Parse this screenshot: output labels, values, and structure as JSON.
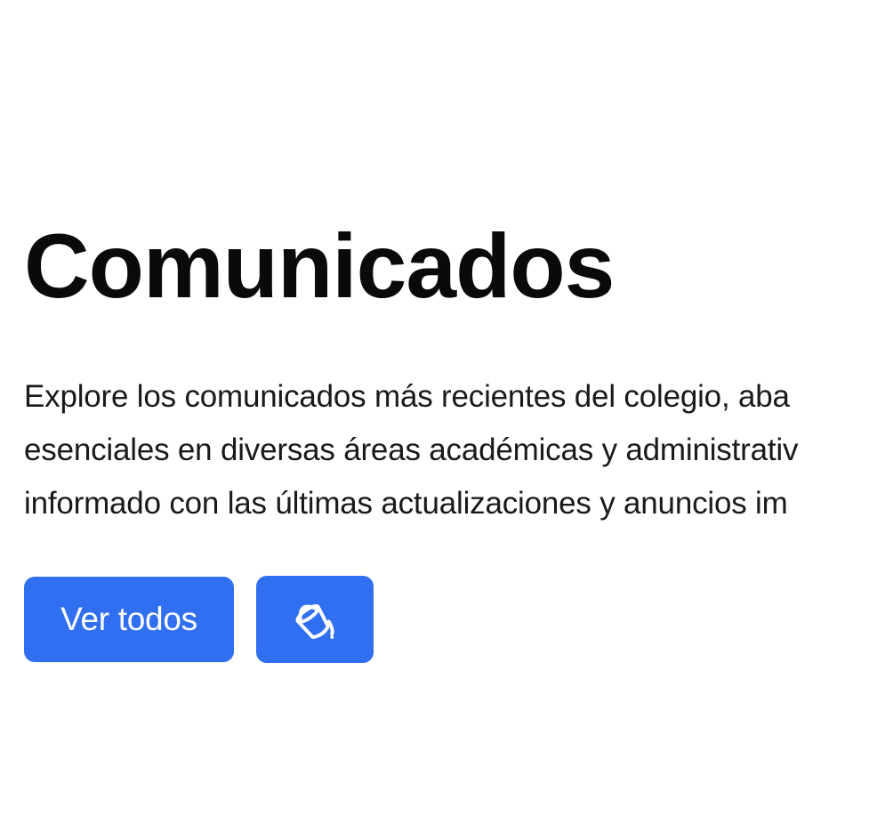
{
  "hero": {
    "title": "Comunicados",
    "description_lines": [
      "Explore los comunicados más recientes del colegio, aba",
      "esenciales en diversas áreas académicas y administrativ",
      "informado con las últimas actualizaciones y anuncios im"
    ]
  },
  "actions": {
    "view_all_label": "Ver todos",
    "theme_button_icon": "paint-bucket-icon"
  },
  "colors": {
    "accent": "#2f6ff0",
    "text": "#0a0a0a",
    "background": "#ffffff"
  }
}
